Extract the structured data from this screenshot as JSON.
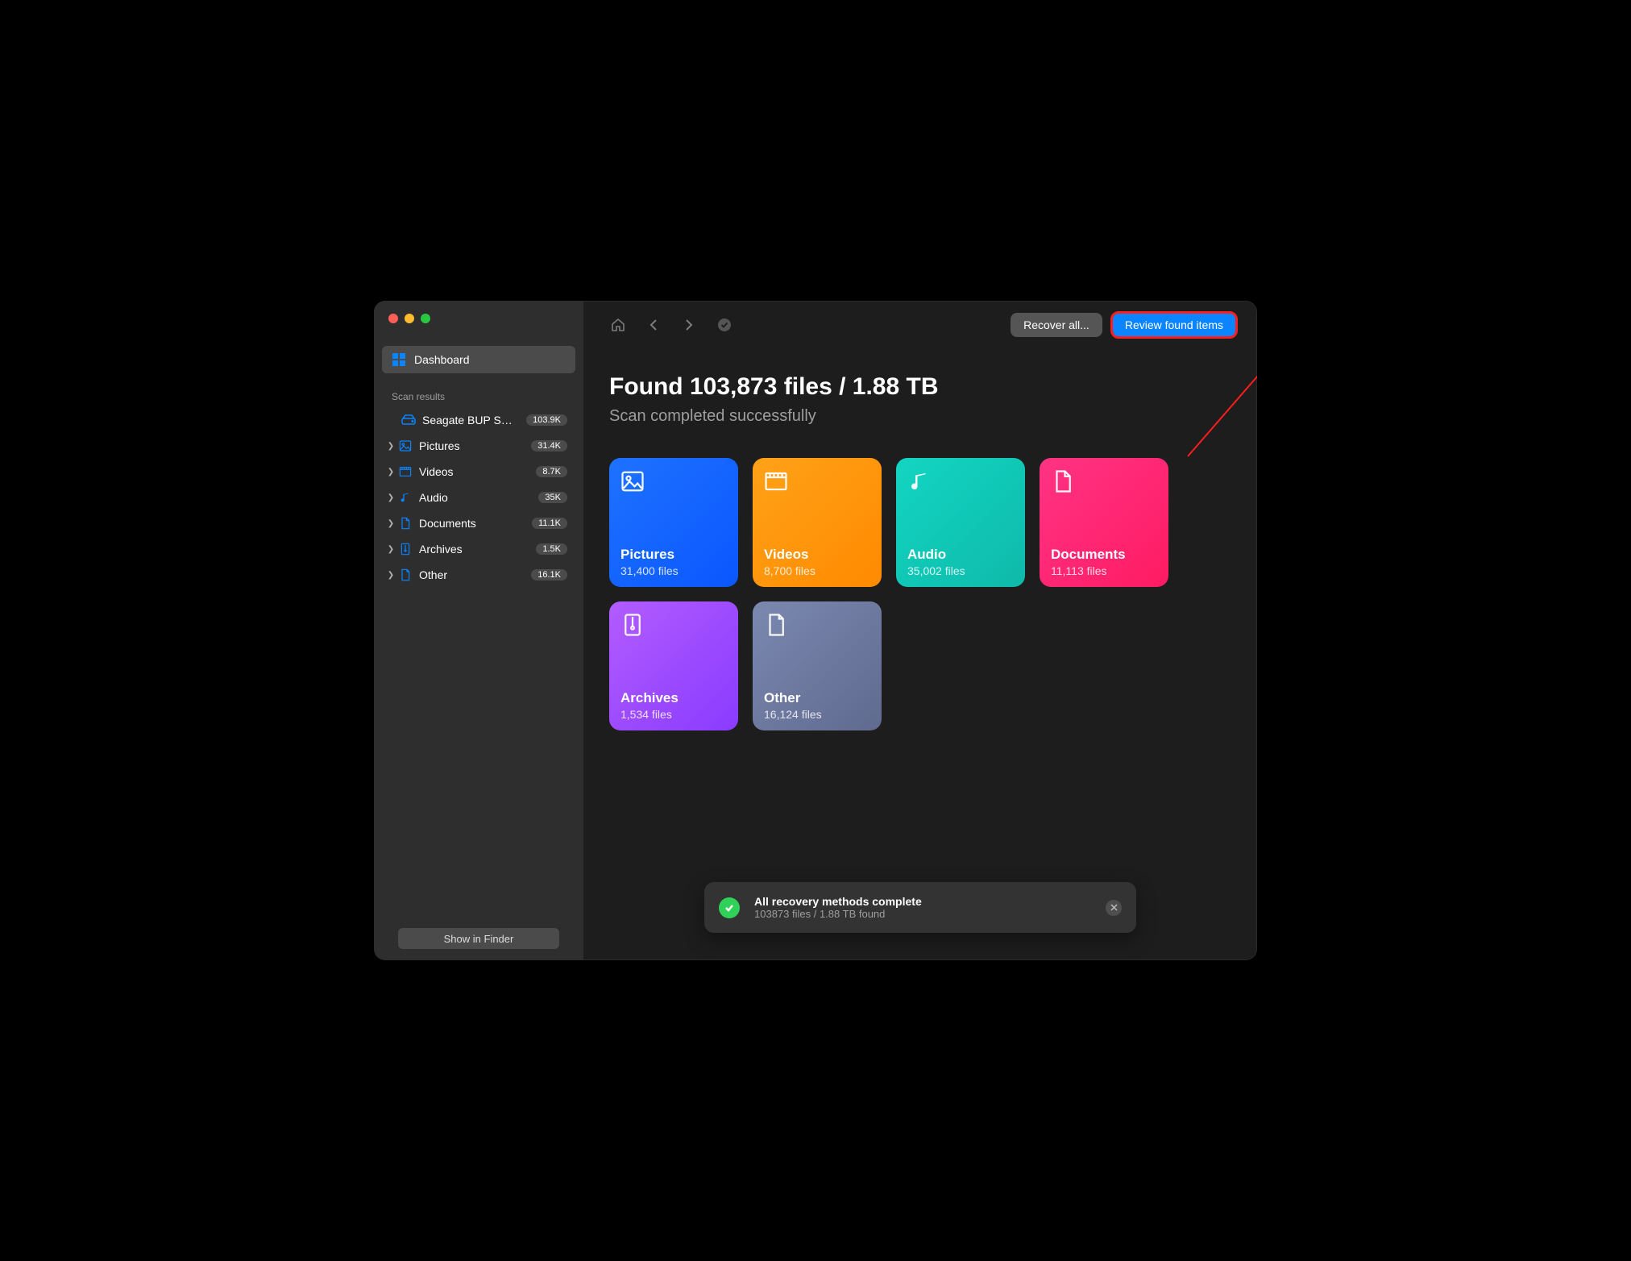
{
  "sidebar": {
    "dashboard_label": "Dashboard",
    "section_label": "Scan results",
    "drive": {
      "label": "Seagate BUP S…",
      "badge": "103.9K"
    },
    "items": [
      {
        "label": "Pictures",
        "badge": "31.4K",
        "icon": "picture",
        "color": "#0a84ff"
      },
      {
        "label": "Videos",
        "badge": "8.7K",
        "icon": "video",
        "color": "#0a84ff"
      },
      {
        "label": "Audio",
        "badge": "35K",
        "icon": "audio",
        "color": "#0a84ff"
      },
      {
        "label": "Documents",
        "badge": "11.1K",
        "icon": "document",
        "color": "#0a84ff"
      },
      {
        "label": "Archives",
        "badge": "1.5K",
        "icon": "archive",
        "color": "#0a84ff"
      },
      {
        "label": "Other",
        "badge": "16.1K",
        "icon": "other",
        "color": "#0a84ff"
      }
    ],
    "footer_label": "Show in Finder"
  },
  "topbar": {
    "recover_all": "Recover all...",
    "review": "Review found items"
  },
  "header": {
    "title": "Found 103,873 files / 1.88 TB",
    "subtitle": "Scan completed successfully"
  },
  "cards": [
    {
      "title": "Pictures",
      "sub": "31,400 files",
      "bg": "linear-gradient(135deg,#1e72ff,#0a57ff)",
      "icon": "picture"
    },
    {
      "title": "Videos",
      "sub": "8,700 files",
      "bg": "linear-gradient(135deg,#ffa218,#ff8a00)",
      "icon": "video"
    },
    {
      "title": "Audio",
      "sub": "35,002 files",
      "bg": "linear-gradient(135deg,#12d6c2,#0fb9aa)",
      "icon": "audio"
    },
    {
      "title": "Documents",
      "sub": "11,113 files",
      "bg": "linear-gradient(135deg,#ff3384,#ff1b63)",
      "icon": "document"
    },
    {
      "title": "Archives",
      "sub": "1,534 files",
      "bg": "linear-gradient(135deg,#b25cff,#8a3bff)",
      "icon": "archive"
    },
    {
      "title": "Other",
      "sub": "16,124 files",
      "bg": "linear-gradient(135deg,#7b88b0,#606a8f)",
      "icon": "other"
    }
  ],
  "toast": {
    "title": "All recovery methods complete",
    "subtitle": "103873 files / 1.88 TB found"
  },
  "annotation": {
    "highlight": "review-button",
    "arrow_color": "#ff1d1d"
  }
}
